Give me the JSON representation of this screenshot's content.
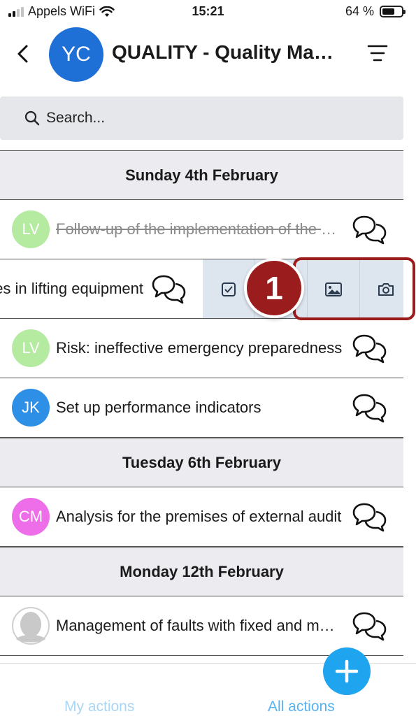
{
  "status_bar": {
    "carrier": "Appels WiFi",
    "time": "15:21",
    "battery": "64 %",
    "battery_level": 0.64
  },
  "header": {
    "avatar_initials": "YC",
    "avatar_color": "#1e6fd6",
    "title": "QUALITY - Quality Management"
  },
  "search": {
    "placeholder": "Search..."
  },
  "sections": [
    {
      "day": "Sunday 4th February",
      "items": [
        {
          "initials": "LV",
          "avatar_color": "#b5eba0",
          "label": "Follow-up of the implementation of the action plan",
          "completed": true
        },
        {
          "initials": "",
          "avatar_color": "",
          "label": "Anomalies in lifting equipment",
          "swiped": true
        },
        {
          "initials": "LV",
          "avatar_color": "#b5eba0",
          "label": "Risk: ineffective emergency preparedness"
        },
        {
          "initials": "JK",
          "avatar_color": "#2e8fe6",
          "label": "Set up performance indicators"
        }
      ]
    },
    {
      "day": "Tuesday 6th February",
      "items": [
        {
          "initials": "CM",
          "avatar_color": "#ee6de8",
          "label": "Analysis for the premises of external audit"
        }
      ]
    },
    {
      "day": "Monday 12th February",
      "items": [
        {
          "initials": "",
          "avatar_color": "#c9c9c9",
          "label": "Management of faults with fixed and mobile equipment"
        }
      ]
    }
  ],
  "swipe_actions": [
    "checkbox-icon",
    "image-icon",
    "camera-icon"
  ],
  "step_badge": "1",
  "tabs": {
    "my_actions": "My actions",
    "all_actions": "All actions"
  },
  "colors": {
    "accent": "#1fa5ef",
    "highlight": "#9b1c1c",
    "tray": "#dde5ef"
  }
}
